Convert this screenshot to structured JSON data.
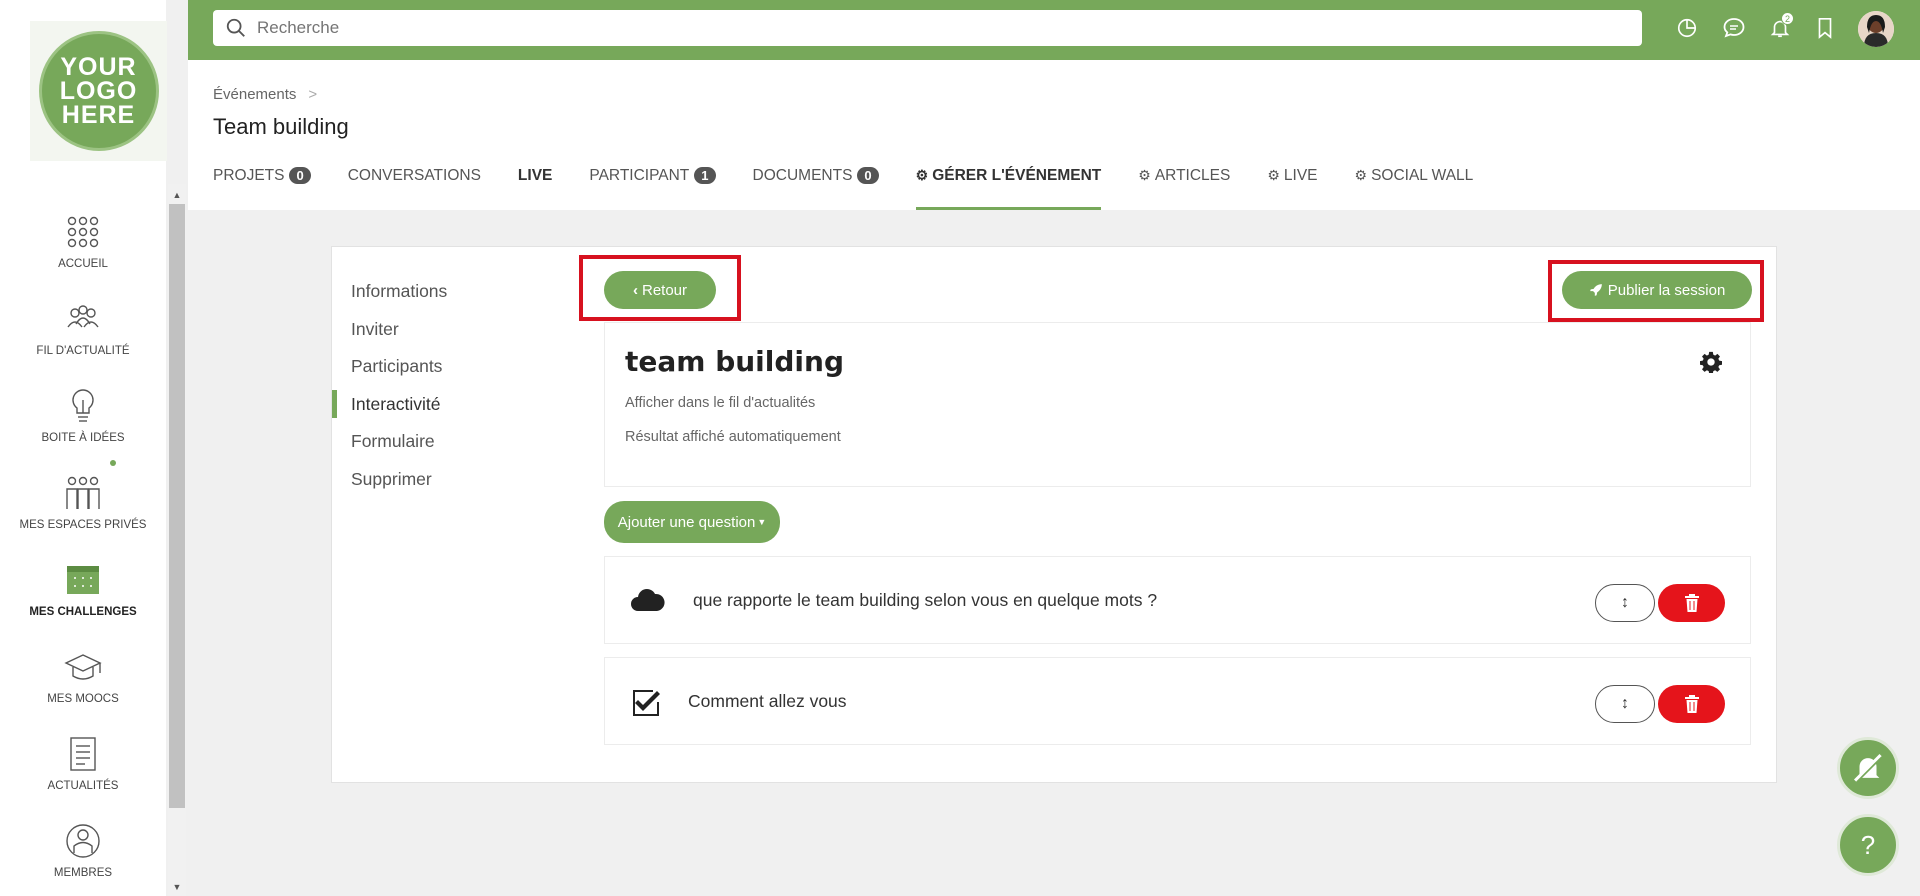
{
  "logo": {
    "lines": [
      "YOUR",
      "LOGO",
      "HERE"
    ]
  },
  "search": {
    "placeholder": "Recherche"
  },
  "topbar": {
    "notifications_count": "2"
  },
  "sidebar": {
    "items": [
      {
        "label": "ACCUEIL",
        "icon": "grid-dots-icon"
      },
      {
        "label": "FIL D'ACTUALITÉ",
        "icon": "people-group-icon"
      },
      {
        "label": "BOITE À IDÉES",
        "icon": "lightbulb-icon"
      },
      {
        "label": "MES ESPACES PRIVÉS",
        "icon": "private-spaces-icon"
      },
      {
        "label": "MES CHALLENGES",
        "icon": "calendar-icon"
      },
      {
        "label": "MES MOOCS",
        "icon": "graduation-cap-icon"
      },
      {
        "label": "ACTUALITÉS",
        "icon": "document-icon"
      },
      {
        "label": "MEMBRES",
        "icon": "member-icon"
      }
    ]
  },
  "header": {
    "breadcrumb": "Événements",
    "title": "Team building",
    "tabs": [
      {
        "label": "PROJETS",
        "count": "0"
      },
      {
        "label": "CONVERSATIONS"
      },
      {
        "label": "LIVE"
      },
      {
        "label": "PARTICIPANT",
        "count": "1"
      },
      {
        "label": "DOCUMENTS",
        "count": "0"
      },
      {
        "label": "GÉRER L'ÉVÉNEMENT"
      },
      {
        "label": "ARTICLES"
      },
      {
        "label": "LIVE"
      },
      {
        "label": "SOCIAL WALL"
      }
    ]
  },
  "side_menu": {
    "items": [
      "Informations",
      "Inviter",
      "Participants",
      "Interactivité",
      "Formulaire",
      "Supprimer"
    ],
    "active": "Interactivité"
  },
  "actions": {
    "back_label": "Retour",
    "publish_label": "Publier la session",
    "add_question_label": "Ajouter une question"
  },
  "session": {
    "title": "team building",
    "line1": "Afficher dans le fil d'actualités",
    "line2": "Résultat affiché automatiquement"
  },
  "questions": [
    {
      "text": "que rapporte le team building selon vous en quelque mots ?",
      "icon": "cloud-icon"
    },
    {
      "text": "Comment allez vous",
      "icon": "checkbox-icon"
    }
  ],
  "fab": {
    "help_label": "?"
  },
  "colors": {
    "accent": "#77a85a",
    "danger": "#e5141b",
    "highlight": "#d7111f"
  }
}
